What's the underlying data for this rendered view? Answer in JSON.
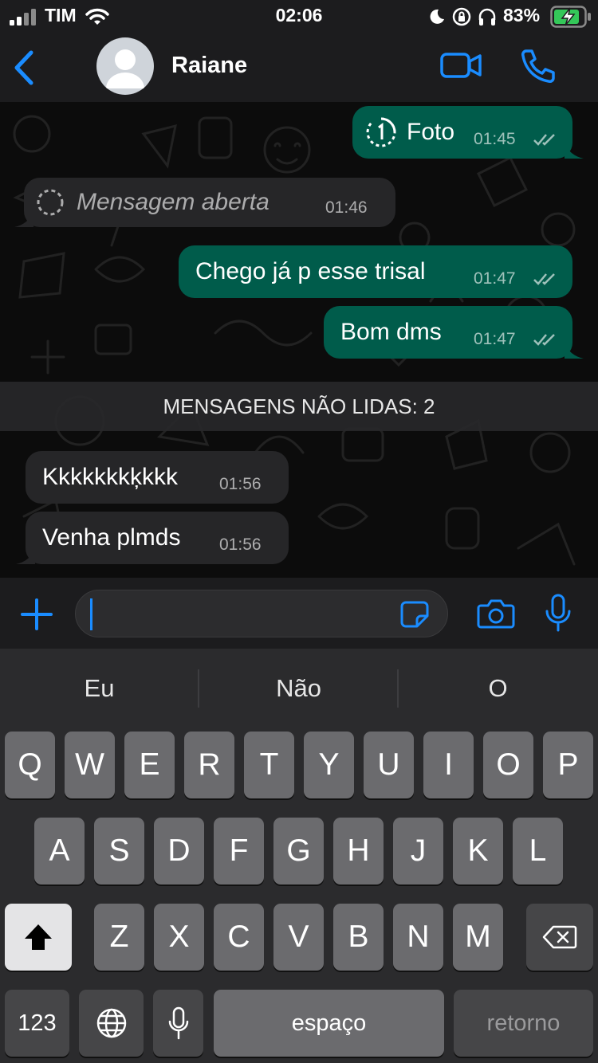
{
  "status_bar": {
    "carrier": "TIM",
    "time": "02:06",
    "battery": "83%"
  },
  "header": {
    "contact_name": "Raiane"
  },
  "messages": [
    {
      "direction": "out",
      "icon": "view-once-icon",
      "text": "Foto",
      "time": "01:45",
      "read": true
    },
    {
      "direction": "in",
      "icon": "opened-view-once-icon",
      "text": "Mensagem aberta",
      "time": "01:46"
    },
    {
      "direction": "out",
      "text": "Chego já p esse trisal",
      "time": "01:47",
      "read": true
    },
    {
      "direction": "out",
      "text": "Bom dms",
      "time": "01:47",
      "read": true
    },
    {
      "direction": "in",
      "text": "Kkkkkkkķkkk",
      "time": "01:56"
    },
    {
      "direction": "in",
      "text": "Venha plmds",
      "time": "01:56"
    }
  ],
  "unread_divider": "MENSAGENS NÃO LIDAS: 2",
  "composer": {
    "value": "",
    "placeholder": ""
  },
  "keyboard": {
    "suggestions": [
      "Eu",
      "Não",
      "O"
    ],
    "rows": [
      [
        "Q",
        "W",
        "E",
        "R",
        "T",
        "Y",
        "U",
        "I",
        "O",
        "P"
      ],
      [
        "A",
        "S",
        "D",
        "F",
        "G",
        "H",
        "J",
        "K",
        "L"
      ],
      [
        "Z",
        "X",
        "C",
        "V",
        "B",
        "N",
        "M"
      ]
    ],
    "numbers_label": "123",
    "space_label": "espaço",
    "return_label": "retorno"
  },
  "colors": {
    "accent": "#1a8cff",
    "outgoing_bubble": "#005c4b",
    "incoming_bubble": "#262628",
    "battery": "#34c759"
  }
}
